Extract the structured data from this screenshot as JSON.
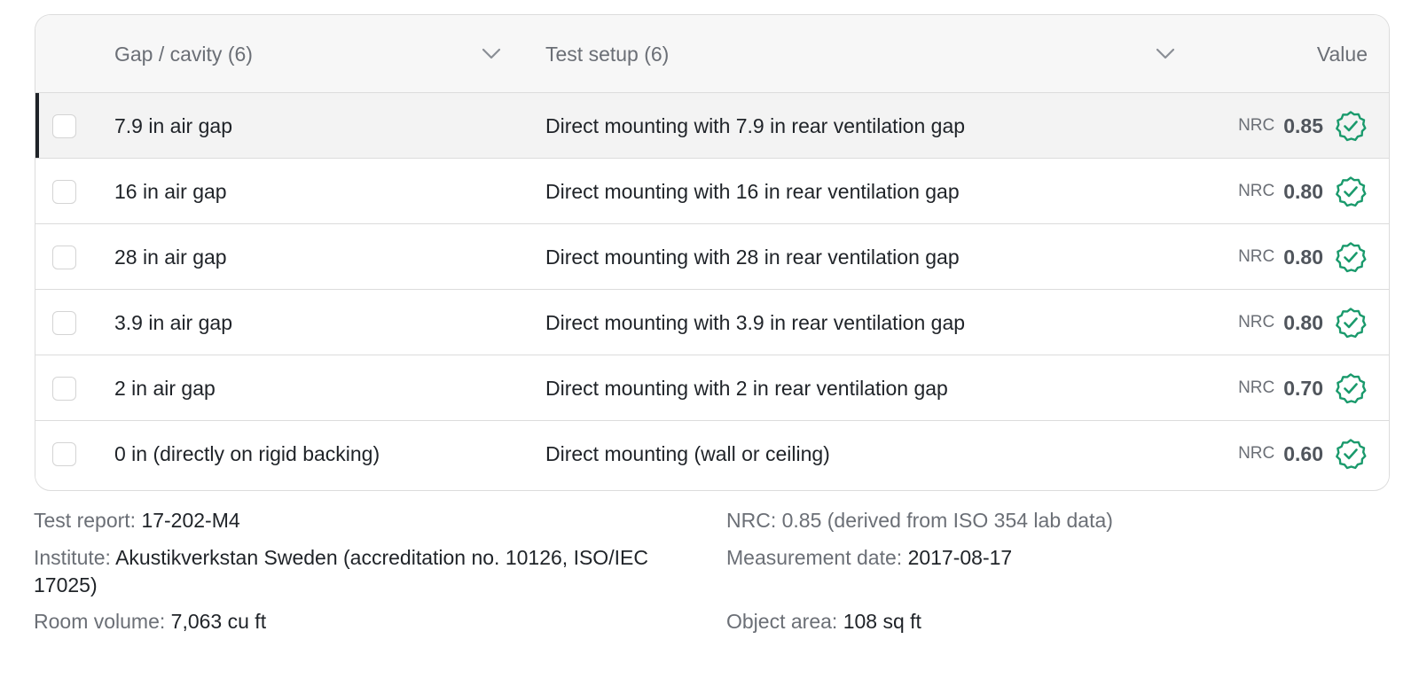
{
  "table": {
    "headers": {
      "gap": "Gap / cavity (6)",
      "setup": "Test setup (6)",
      "value": "Value"
    },
    "rows": [
      {
        "gap": "7.9 in air gap",
        "setup": "Direct mounting with 7.9 in rear ventilation gap",
        "unit": "NRC",
        "value": "0.85",
        "selected": true
      },
      {
        "gap": "16 in air gap",
        "setup": "Direct mounting with 16 in rear ventilation gap",
        "unit": "NRC",
        "value": "0.80",
        "selected": false
      },
      {
        "gap": "28 in air gap",
        "setup": "Direct mounting with 28 in rear ventilation gap",
        "unit": "NRC",
        "value": "0.80",
        "selected": false
      },
      {
        "gap": "3.9 in air gap",
        "setup": "Direct mounting with 3.9 in rear ventilation gap",
        "unit": "NRC",
        "value": "0.80",
        "selected": false
      },
      {
        "gap": "2 in air gap",
        "setup": "Direct mounting with 2 in rear ventilation gap",
        "unit": "NRC",
        "value": "0.70",
        "selected": false
      },
      {
        "gap": "0 in (directly on rigid backing)",
        "setup": "Direct mounting (wall or ceiling)",
        "unit": "NRC",
        "value": "0.60",
        "selected": false
      }
    ]
  },
  "details": {
    "test_report_label": "Test report:",
    "test_report_value": "17-202-M4",
    "institute_label": "Institute:",
    "institute_value": "Akustikverkstan Sweden (accreditation no. 10126, ISO/IEC 17025)",
    "room_volume_label": "Room volume:",
    "room_volume_value": "7,063 cu ft",
    "nrc_note": "NRC: 0.85 (derived from ISO 354 lab data)",
    "measurement_date_label": "Measurement date:",
    "measurement_date_value": "2017-08-17",
    "object_area_label": "Object area:",
    "object_area_value": "108 sq ft"
  },
  "colors": {
    "verified_green": "#1a9a6c",
    "selected_bar": "#1f2328"
  },
  "icons": {
    "sort": "chevron-down-icon",
    "verified": "verified-badge-icon"
  }
}
